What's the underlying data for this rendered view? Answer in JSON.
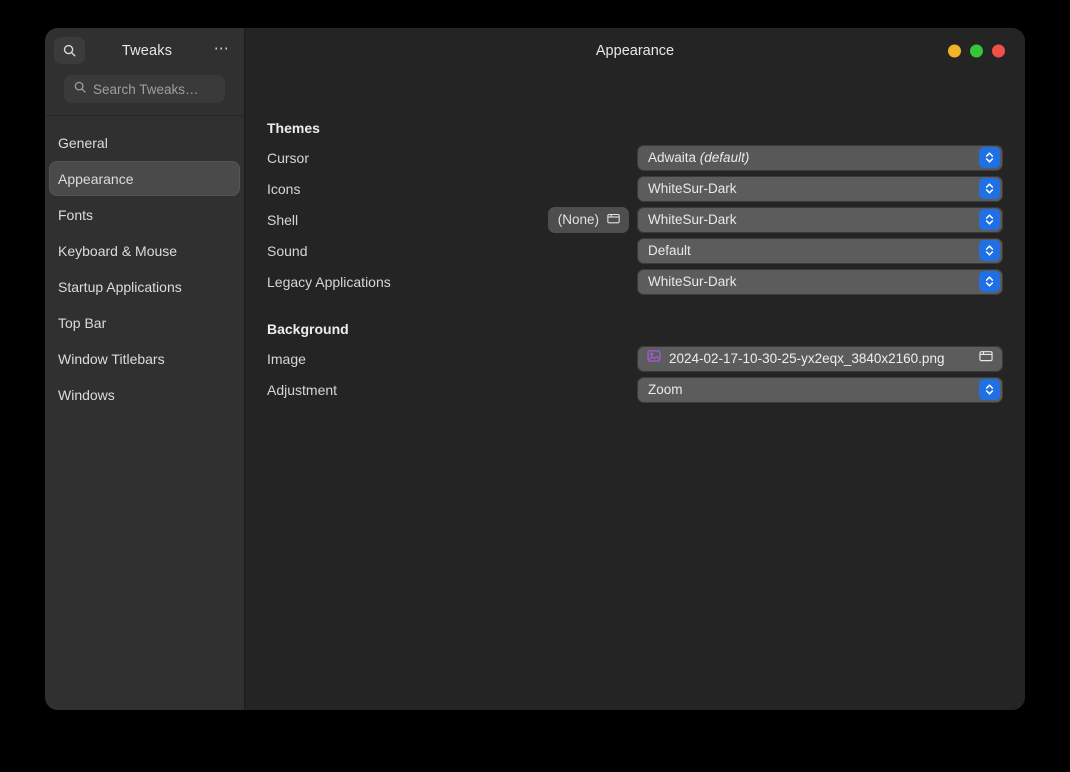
{
  "window": {
    "app_title": "Tweaks",
    "page_title": "Appearance",
    "search_icon": "search-icon",
    "menu_icon": "ellipsis-icon",
    "menu_label": "⋯",
    "controls": [
      {
        "name": "minimize",
        "color": "#f0b429"
      },
      {
        "name": "maximize",
        "color": "#35c63a"
      },
      {
        "name": "close",
        "color": "#f05249"
      }
    ]
  },
  "search": {
    "placeholder": "Search Tweaks…",
    "value": "",
    "icon": "search-icon"
  },
  "sidebar": {
    "items": [
      {
        "label": "General",
        "selected": false
      },
      {
        "label": "Appearance",
        "selected": true
      },
      {
        "label": "Fonts",
        "selected": false
      },
      {
        "label": "Keyboard & Mouse",
        "selected": false
      },
      {
        "label": "Startup Applications",
        "selected": false
      },
      {
        "label": "Top Bar",
        "selected": false
      },
      {
        "label": "Window Titlebars",
        "selected": false
      },
      {
        "label": "Windows",
        "selected": false
      }
    ]
  },
  "groups": [
    {
      "title": "Themes",
      "rows": [
        {
          "label": "Cursor",
          "control": "combo",
          "value": "Adwaita",
          "value_suffix": "(default)",
          "suffix_italic": true,
          "style": "subtle"
        },
        {
          "label": "Icons",
          "control": "combo",
          "value": "WhiteSur-Dark",
          "value_suffix": "",
          "suffix_italic": false,
          "style": "normal"
        },
        {
          "label": "Shell",
          "control": "combo",
          "value": "WhiteSur-Dark",
          "value_suffix": "",
          "suffix_italic": false,
          "style": "normal",
          "mid_button": {
            "label": "(None)",
            "icon": "folder-icon"
          }
        },
        {
          "label": "Sound",
          "control": "combo",
          "value": "Default",
          "value_suffix": "",
          "suffix_italic": false,
          "style": "normal"
        },
        {
          "label": "Legacy Applications",
          "control": "combo",
          "value": "WhiteSur-Dark",
          "value_suffix": "",
          "suffix_italic": false,
          "style": "normal"
        }
      ]
    },
    {
      "title": "Background",
      "rows": [
        {
          "label": "Image",
          "control": "file",
          "value": "2024-02-17-10-30-25-yx2eqx_3840x2160.png",
          "leading_icon": "image-icon",
          "trailing_icon": "folder-icon"
        },
        {
          "label": "Adjustment",
          "control": "combo",
          "value": "Zoom",
          "value_suffix": "",
          "suffix_italic": false,
          "style": "normal"
        }
      ]
    }
  ],
  "colors": {
    "desktop": "#000000",
    "sidebar": "#303030",
    "content": "#242424",
    "selected_item": "#4a4a4a",
    "combo": "#5c5c5c",
    "accent_blue": "#1f6fe5",
    "image_icon_purple": "#a05cd6"
  }
}
